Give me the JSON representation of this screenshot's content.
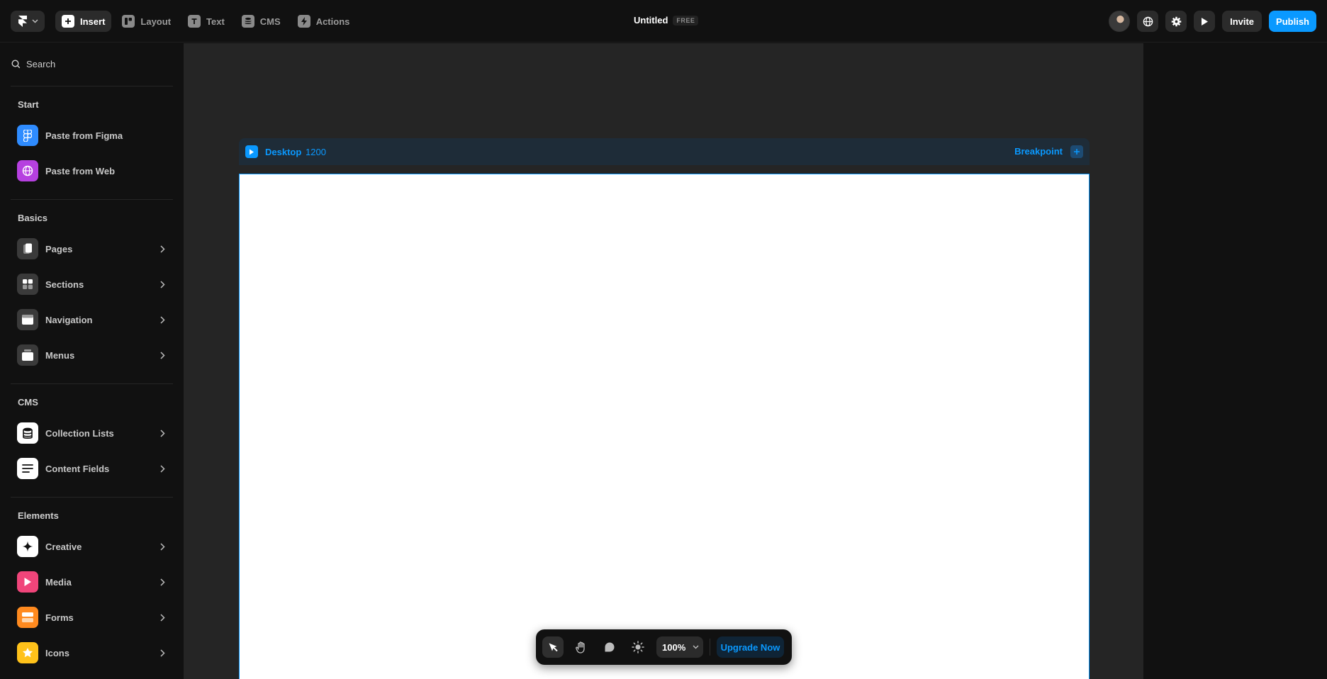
{
  "colors": {
    "accent": "#0a99ff",
    "background": "#111111",
    "canvas": "#252525"
  },
  "topbar": {
    "logo_icon": "framer-logo-icon",
    "nav": [
      {
        "label": "Insert",
        "icon": "plus-icon",
        "active": true
      },
      {
        "label": "Layout",
        "icon": "layout-icon",
        "active": false
      },
      {
        "label": "Text",
        "icon": "text-icon",
        "active": false
      },
      {
        "label": "CMS",
        "icon": "database-icon",
        "active": false
      },
      {
        "label": "Actions",
        "icon": "lightning-icon",
        "active": false
      }
    ],
    "doc_title": "Untitled",
    "plan_badge": "FREE",
    "invite_label": "Invite",
    "publish_label": "Publish"
  },
  "sidebar": {
    "search_placeholder": "Search",
    "sections": [
      {
        "title": "Start",
        "items": [
          {
            "label": "Paste from Figma",
            "icon": "figma-icon",
            "color": "#2f8cff"
          },
          {
            "label": "Paste from Web",
            "icon": "globe-icon",
            "color": "#b640e0"
          }
        ]
      },
      {
        "title": "Basics",
        "items": [
          {
            "label": "Pages",
            "icon": "page-icon",
            "color": "#3a3a3a"
          },
          {
            "label": "Sections",
            "icon": "sections-icon",
            "color": "#3a3a3a"
          },
          {
            "label": "Navigation",
            "icon": "navigation-icon",
            "color": "#3a3a3a"
          },
          {
            "label": "Menus",
            "icon": "menus-icon",
            "color": "#3a3a3a"
          }
        ]
      },
      {
        "title": "CMS",
        "items": [
          {
            "label": "Collection Lists",
            "icon": "database-icon",
            "color": "#ffffff"
          },
          {
            "label": "Content Fields",
            "icon": "text-lines-icon",
            "color": "#ffffff"
          }
        ]
      },
      {
        "title": "Elements",
        "items": [
          {
            "label": "Creative",
            "icon": "sparkle-icon",
            "color": "#ffffff"
          },
          {
            "label": "Media",
            "icon": "play-icon",
            "color": "#f0457a"
          },
          {
            "label": "Forms",
            "icon": "form-icon",
            "color": "#ff8a1f"
          },
          {
            "label": "Icons",
            "icon": "star-icon",
            "color": "#ffc21a"
          }
        ]
      }
    ]
  },
  "canvas": {
    "breakpoint_name": "Desktop",
    "breakpoint_width": "1200",
    "add_breakpoint_label": "Breakpoint"
  },
  "toolbar": {
    "tools": [
      "select-arrow-icon",
      "hand-icon",
      "comment-icon",
      "theme-sun-icon"
    ],
    "zoom": "100%",
    "upgrade_label": "Upgrade Now"
  }
}
